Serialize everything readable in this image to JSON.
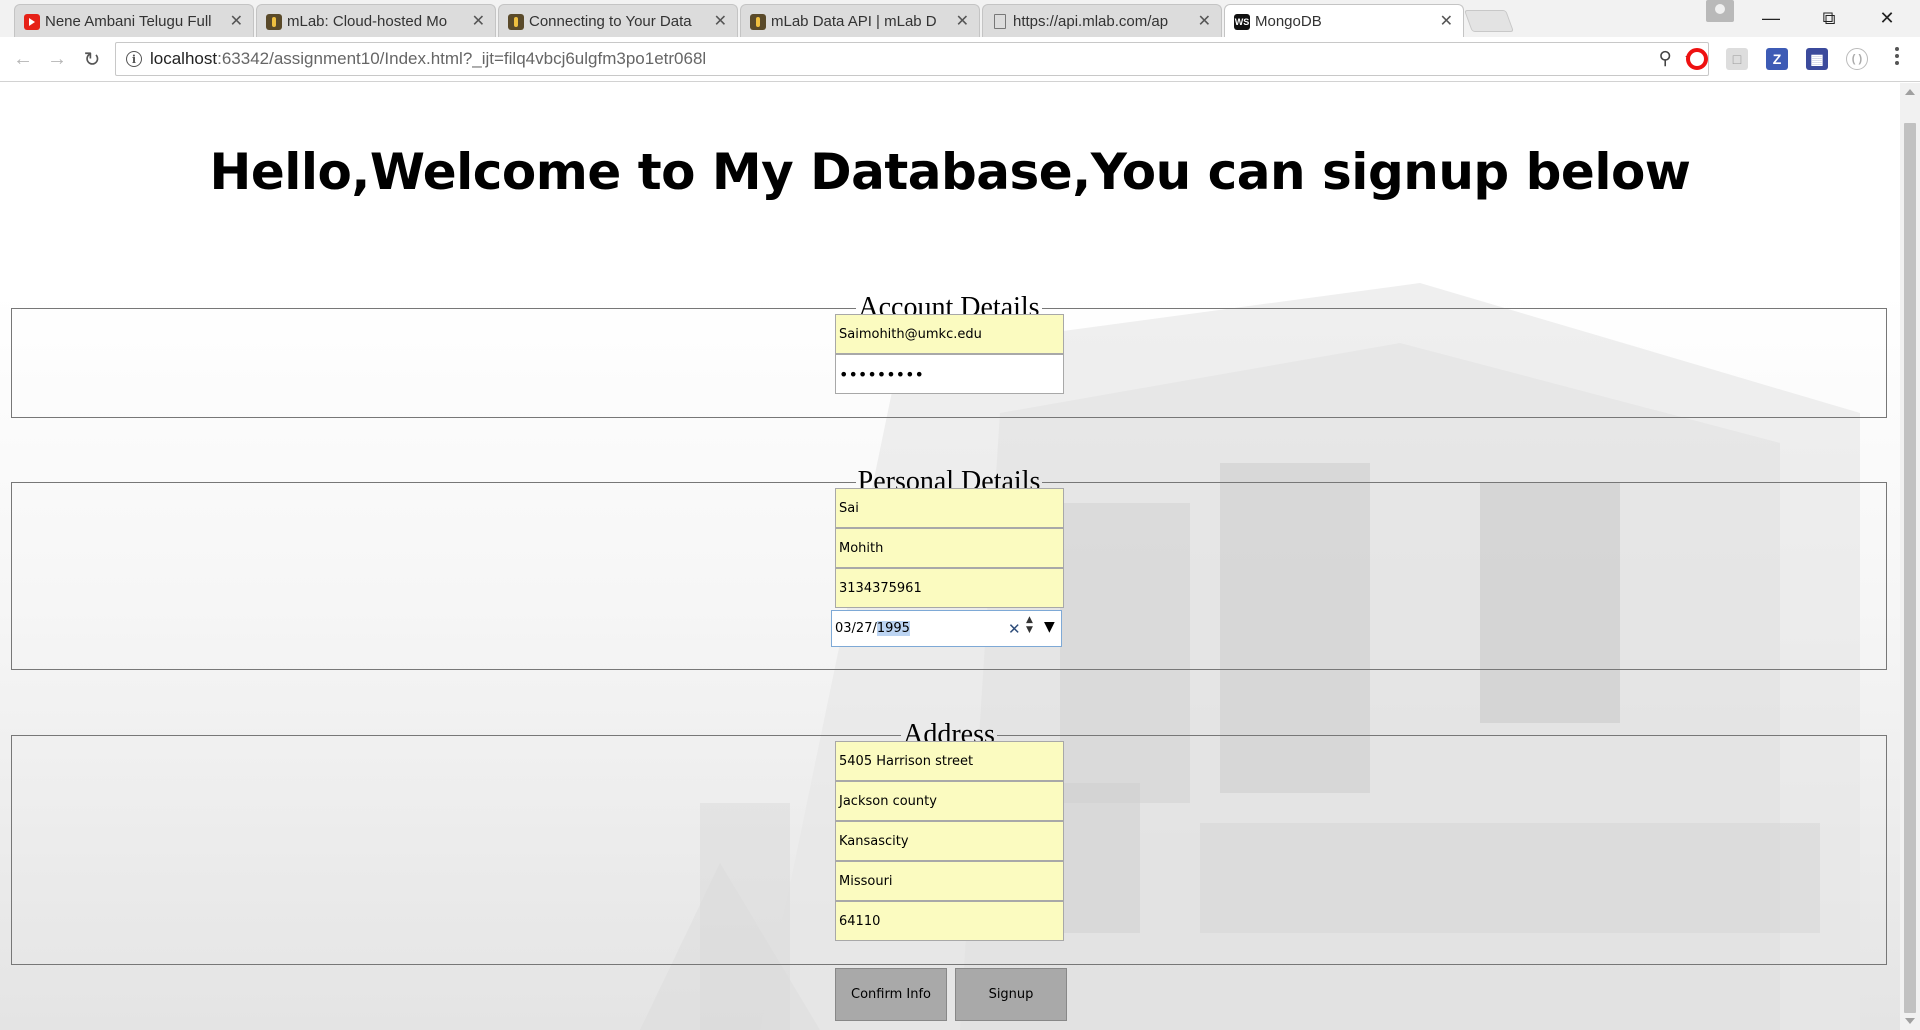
{
  "browser": {
    "tabs": [
      {
        "title": "Nene Ambani Telugu Full",
        "favicon": "youtube-icon"
      },
      {
        "title": "mLab: Cloud-hosted Mo",
        "favicon": "mlab-icon"
      },
      {
        "title": "Connecting to Your Data",
        "favicon": "mlab-icon"
      },
      {
        "title": "mLab Data API | mLab D",
        "favicon": "mlab-icon"
      },
      {
        "title": "https://api.mlab.com/ap",
        "favicon": "document-icon"
      },
      {
        "title": "MongoDB",
        "favicon": "webstorm-icon",
        "active": true
      }
    ],
    "url_host": "localhost",
    "url_rest": ":63342/assignment10/Index.html?_ijt=filq4vbcj6ulgfm3po1etr068l",
    "ws_badge": "WS"
  },
  "page": {
    "title": "Hello,Welcome to My Database,You can signup below",
    "account": {
      "legend": "Account Details",
      "email": "Saimohith@umkc.edu",
      "password_mask": "•••••••••"
    },
    "personal": {
      "legend": "Personal Details",
      "first_name": "Sai",
      "last_name": "Mohith",
      "phone": "3134375961",
      "dob_prefix": "03/27/",
      "dob_year": "1995"
    },
    "address": {
      "legend": "Address",
      "street": "5405 Harrison street",
      "county": "Jackson county",
      "city": "Kansascity",
      "state": "Missouri",
      "zip": "64110"
    },
    "buttons": {
      "confirm": "Confirm Info",
      "signup": "Signup"
    }
  },
  "colors": {
    "field_bg": "#fbfbc0",
    "button_bg": "#a9a9a9",
    "date_focus": "#7ea9d6"
  }
}
